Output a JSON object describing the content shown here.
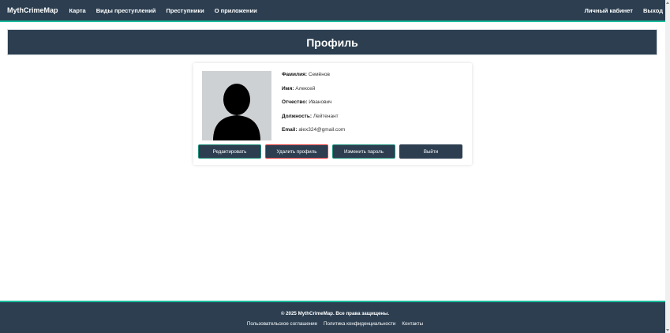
{
  "navbar": {
    "brand": "MythCrimeMap",
    "links": [
      "Карта",
      "Виды преступлений",
      "Преступники",
      "О приложении"
    ],
    "right_links": [
      "Личный кабинет",
      "Выход"
    ]
  },
  "page": {
    "title": "Профиль"
  },
  "profile": {
    "avatar_icon": "user-silhouette-icon",
    "fields": [
      {
        "label": "Фамилия:",
        "value": "Семёнов"
      },
      {
        "label": "Имя:",
        "value": "Алексей"
      },
      {
        "label": "Отчество:",
        "value": "Иванович"
      },
      {
        "label": "Должность:",
        "value": "Лейтенант"
      },
      {
        "label": "Email:",
        "value": "alex324@gmail.com"
      }
    ],
    "buttons": [
      "Редактировать",
      "Удалить профиль",
      "Изменить пароль",
      "Выйти"
    ]
  },
  "footer": {
    "copyright": "© 2025 MythCrimeMap. Все права защищены.",
    "links": [
      "Пользовательское соглашение",
      "Политика конфиденциальности",
      "Контакты"
    ]
  },
  "colors": {
    "primary": "#2c3e50",
    "accent": "#1abc9c",
    "danger": "#e03c3c"
  }
}
